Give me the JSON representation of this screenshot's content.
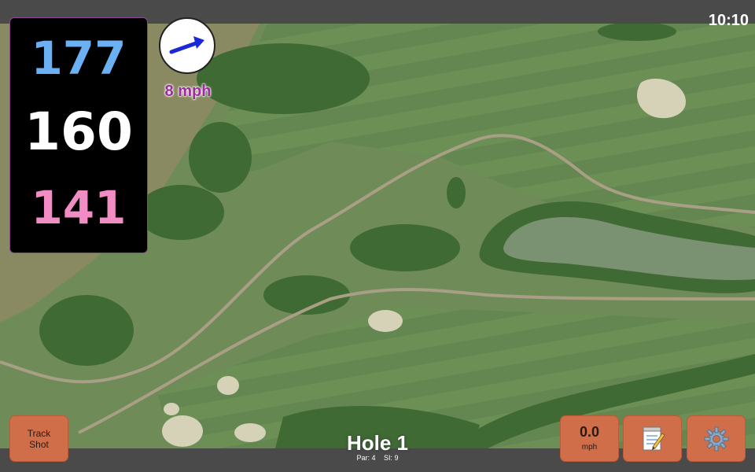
{
  "status_bar": {
    "time": "10:10"
  },
  "distances": {
    "back": "177",
    "middle": "160",
    "front": "141",
    "colors": {
      "back": "#6ab0f2",
      "middle": "#ffffff",
      "front": "#f28cc4"
    }
  },
  "wind": {
    "speed_label": "8 mph",
    "arrow_icon": "wind-direction-arrow-icon",
    "arrow_color": "#1a28d8",
    "label_color": "#a02aa0"
  },
  "buttons": {
    "track_shot": "Track\nShot",
    "speed_value": "0.0",
    "speed_unit": "mph",
    "notes_icon": "notepad-icon",
    "settings_icon": "gear-icon",
    "accent": "#cf6e48"
  },
  "hole": {
    "title": "Hole 1",
    "par": "Par: 4",
    "stroke_index": "SI: 9"
  }
}
